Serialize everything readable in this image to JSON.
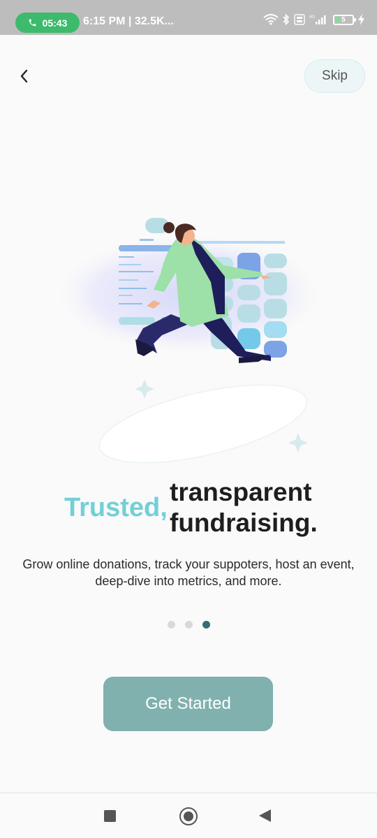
{
  "status_bar": {
    "call_timer": "05:43",
    "status_text": "6:15 PM | 32.5K...",
    "network": "4G",
    "battery": "5"
  },
  "header": {
    "skip_label": "Skip"
  },
  "hero": {
    "highlight": "Trusted,",
    "line1": "transparent",
    "line2": "fundraising.",
    "subtitle": "Grow online donations, track your suppoters, host an event, deep-dive into metrics, and more."
  },
  "pager": {
    "total": 3,
    "active_index": 2
  },
  "cta": {
    "label": "Get Started"
  },
  "colors": {
    "accent_teal": "#73cfd7",
    "button": "#80b1ae",
    "active_dot": "#2f6e72",
    "call_pill": "#3dba6c"
  }
}
